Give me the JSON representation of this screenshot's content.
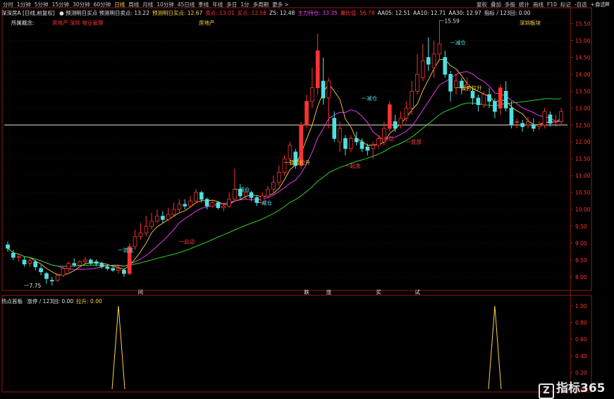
{
  "toolbar": {
    "periods": [
      "分时",
      "1分钟",
      "5分钟",
      "15分钟",
      "30分钟",
      "60分钟",
      "日线",
      "周线",
      "月线",
      "10分钟",
      "45日线",
      "季线",
      "年线",
      "多日",
      "1分",
      "多周期",
      "更多 >"
    ],
    "active_period": "日线",
    "right": [
      "复权",
      "叠加",
      "多股",
      "统计",
      "画线",
      "F10",
      "标记",
      "-自选",
      "+自选"
    ],
    "window_buttons": [
      "▫",
      "⊠"
    ]
  },
  "indicator_bar": {
    "title": "深深房A [日线,前复权]",
    "items": [
      {
        "text": "● 预测明日买点 预测明日卖点: 13.22",
        "color": "#e0e0e0"
      },
      {
        "text": "预测明日买点: 12.67",
        "color": "#ffd24a"
      },
      {
        "text": "卖点: 13.01",
        "color": "#ff3232"
      },
      {
        "text": "买点: 12.58",
        "color": "#ff3232"
      },
      {
        "text": "ZS: 12.48",
        "color": "#e0e0e0"
      },
      {
        "text": "主力持仓: 33.35",
        "color": "#ff40ff"
      },
      {
        "text": "量比值: 56.78",
        "color": "#ff3232"
      },
      {
        "text": "AA05: 12.51",
        "color": "#e0e0e0"
      },
      {
        "text": "AA10: 12.71",
        "color": "#e0e0e0"
      },
      {
        "text": "AA30: 12.97",
        "color": "#e0e0e0"
      },
      {
        "text": "指标 / 123回: 0.00",
        "color": "#e0e0e0"
      }
    ]
  },
  "headers": {
    "concept_label": "所属概念:",
    "concept_value": "房地产 深圳 物业管理",
    "industry": "房地产",
    "region": "深圳板块"
  },
  "price_axis": [
    "15.50",
    "15.00",
    "14.50",
    "14.00",
    "13.50",
    "13.00",
    "12.50",
    "12.00",
    "11.50",
    "11.00",
    "10.50",
    "10.00",
    "9.50",
    "9.00",
    "8.50",
    "8.00"
  ],
  "annotations": [
    {
      "text": "7.75",
      "color": "#e6e6e6"
    },
    {
      "text": "15.59",
      "color": "#e6e6e6"
    },
    {
      "text": "一筑底",
      "color": "#4fe0e0"
    },
    {
      "text": "一启动",
      "color": "#ff4040"
    },
    {
      "text": "一减仓",
      "color": "#4fe0e0"
    },
    {
      "text": "一减仓",
      "color": "#4fe0e0"
    },
    {
      "text": "一启动",
      "color": "#ff4040"
    },
    {
      "text": "一底部",
      "color": "#ff4040"
    },
    {
      "text": "一减仓",
      "color": "#4fe0e0"
    },
    {
      "text": "一减仓",
      "color": "#4fe0e0"
    },
    {
      "text": "一强势拉升",
      "color": "#ffd24a"
    },
    {
      "text": "一起涨",
      "color": "#ff4040"
    },
    {
      "text": "一强势拉升",
      "color": "#ffd24a"
    }
  ],
  "signal_labels": [
    {
      "text": "间",
      "color": "#e6e6e6"
    },
    {
      "text": "跌",
      "color": "#e6e6e6"
    },
    {
      "text": "涨",
      "color": "#e6e6e6"
    },
    {
      "text": "买",
      "color": "#e6e6e6"
    },
    {
      "text": "试",
      "color": "#e6e6e6"
    }
  ],
  "lower_panel": {
    "title": "热点首板",
    "items": [
      {
        "text": "涨停 / 123回: 0.00",
        "color": "#e0e0e0"
      },
      {
        "text": "拉升: 0.00",
        "color": "#ffd24a"
      }
    ],
    "axis": [
      "1.00",
      "0.80",
      "0.60",
      "0.40",
      "0.20",
      "0.00"
    ]
  },
  "logo": {
    "mark": "Z",
    "text": "指标365"
  },
  "chart_data": {
    "type": "candlestick",
    "ylim": [
      7.6,
      15.7
    ],
    "reference_line": 12.5,
    "candles": [
      [
        8.95,
        8.85,
        9.05,
        8.75
      ],
      [
        8.7,
        8.58,
        8.8,
        8.5
      ],
      [
        8.58,
        8.6,
        8.68,
        8.45
      ],
      [
        8.5,
        8.38,
        8.6,
        8.3
      ],
      [
        8.4,
        8.48,
        8.55,
        8.3
      ],
      [
        8.45,
        8.3,
        8.5,
        8.2
      ],
      [
        8.25,
        8.15,
        8.35,
        8.05
      ],
      [
        8.1,
        7.95,
        8.15,
        7.8
      ],
      [
        7.9,
        7.88,
        8.0,
        7.75
      ],
      [
        7.9,
        8.05,
        8.1,
        7.85
      ],
      [
        8.05,
        8.25,
        8.3,
        8.0
      ],
      [
        8.25,
        8.4,
        8.45,
        8.15
      ],
      [
        8.4,
        8.35,
        8.55,
        8.3
      ],
      [
        8.35,
        8.45,
        8.5,
        8.28
      ],
      [
        8.45,
        8.5,
        8.6,
        8.4
      ],
      [
        8.5,
        8.4,
        8.55,
        8.35
      ],
      [
        8.45,
        8.4,
        8.52,
        8.32
      ],
      [
        8.4,
        8.3,
        8.45,
        8.25
      ],
      [
        8.3,
        8.25,
        8.38,
        8.2
      ],
      [
        8.25,
        8.2,
        8.3,
        8.15
      ],
      [
        8.2,
        8.25,
        8.35,
        8.1
      ],
      [
        8.2,
        8.1,
        8.25,
        8.0
      ],
      [
        8.1,
        8.9,
        9.0,
        8.05
      ],
      [
        8.9,
        9.2,
        9.4,
        8.8
      ],
      [
        9.2,
        9.3,
        9.6,
        9.1
      ],
      [
        9.3,
        9.5,
        9.8,
        9.2
      ],
      [
        9.5,
        9.65,
        9.9,
        9.4
      ],
      [
        9.65,
        9.8,
        10.0,
        9.6
      ],
      [
        9.8,
        9.7,
        9.95,
        9.6
      ],
      [
        9.7,
        9.85,
        10.05,
        9.65
      ],
      [
        9.85,
        10.0,
        10.2,
        9.8
      ],
      [
        10.0,
        10.15,
        10.3,
        9.9
      ],
      [
        10.15,
        10.1,
        10.3,
        10.0
      ],
      [
        10.1,
        10.25,
        10.4,
        10.05
      ],
      [
        10.25,
        10.5,
        10.6,
        10.2
      ],
      [
        10.5,
        10.3,
        10.55,
        10.2
      ],
      [
        10.3,
        10.1,
        10.35,
        10.0
      ],
      [
        10.1,
        10.2,
        10.3,
        10.05
      ],
      [
        10.2,
        10.05,
        10.25,
        10.0
      ],
      [
        10.05,
        10.1,
        10.2,
        9.95
      ],
      [
        10.1,
        10.3,
        10.5,
        10.05
      ],
      [
        10.3,
        10.6,
        11.2,
        10.25
      ],
      [
        10.6,
        10.4,
        10.75,
        10.3
      ],
      [
        10.4,
        10.5,
        10.6,
        10.3
      ],
      [
        10.5,
        10.35,
        10.55,
        10.25
      ],
      [
        10.35,
        10.2,
        10.4,
        10.1
      ],
      [
        10.2,
        10.4,
        10.5,
        10.15
      ],
      [
        10.4,
        10.6,
        10.7,
        10.35
      ],
      [
        10.6,
        10.8,
        11.0,
        10.5
      ],
      [
        10.8,
        11.1,
        11.3,
        10.7
      ],
      [
        11.1,
        11.5,
        11.6,
        11.0
      ],
      [
        11.5,
        11.9,
        12.0,
        11.3
      ],
      [
        11.7,
        11.3,
        11.8,
        11.2
      ],
      [
        11.3,
        12.5,
        12.6,
        11.2
      ],
      [
        12.5,
        13.2,
        13.4,
        12.4
      ],
      [
        13.2,
        13.6,
        14.2,
        13.0
      ],
      [
        13.6,
        14.7,
        15.2,
        13.4
      ],
      [
        13.8,
        13.3,
        14.5,
        13.1
      ],
      [
        13.3,
        13.8,
        13.9,
        12.4
      ],
      [
        12.7,
        12.1,
        12.9,
        12.0
      ],
      [
        12.0,
        12.4,
        12.6,
        11.7
      ],
      [
        12.1,
        11.8,
        12.2,
        11.6
      ],
      [
        11.8,
        12.1,
        12.2,
        11.7
      ],
      [
        12.1,
        12.0,
        12.3,
        11.9
      ],
      [
        12.0,
        11.8,
        12.1,
        11.7
      ],
      [
        11.85,
        11.75,
        11.95,
        11.6
      ],
      [
        11.8,
        11.9,
        12.0,
        11.5
      ],
      [
        11.9,
        12.1,
        12.2,
        11.8
      ],
      [
        12.0,
        12.4,
        12.6,
        11.9
      ],
      [
        12.4,
        13.1,
        13.2,
        12.3
      ],
      [
        12.6,
        12.4,
        12.8,
        12.3
      ],
      [
        12.5,
        12.7,
        12.9,
        12.4
      ],
      [
        12.7,
        13.0,
        13.2,
        12.6
      ],
      [
        13.0,
        13.5,
        13.8,
        12.8
      ],
      [
        13.5,
        14.0,
        14.6,
        13.4
      ],
      [
        13.9,
        14.4,
        14.9,
        13.8
      ],
      [
        14.5,
        14.3,
        15.1,
        14.1
      ],
      [
        14.2,
        14.6,
        15.0,
        13.9
      ],
      [
        14.6,
        14.9,
        15.6,
        14.4
      ],
      [
        14.5,
        14.0,
        14.7,
        13.9
      ],
      [
        14.0,
        13.5,
        14.1,
        13.2
      ],
      [
        13.6,
        13.8,
        14.0,
        13.4
      ],
      [
        13.8,
        13.6,
        13.9,
        13.4
      ],
      [
        13.6,
        13.7,
        13.9,
        13.5
      ],
      [
        13.5,
        13.3,
        13.6,
        13.1
      ],
      [
        13.3,
        13.1,
        13.4,
        12.9
      ],
      [
        13.1,
        13.4,
        13.5,
        13.0
      ],
      [
        13.4,
        13.2,
        13.6,
        13.0
      ],
      [
        13.2,
        12.9,
        13.3,
        12.7
      ],
      [
        13.0,
        13.6,
        13.7,
        12.8
      ],
      [
        13.5,
        13.0,
        13.8,
        12.9
      ],
      [
        13.0,
        12.5,
        13.2,
        12.4
      ],
      [
        12.6,
        12.6,
        12.7,
        12.4
      ],
      [
        12.55,
        12.45,
        12.65,
        12.3
      ],
      [
        12.5,
        12.6,
        12.75,
        12.4
      ],
      [
        12.5,
        12.4,
        12.7,
        12.3
      ],
      [
        12.45,
        12.5,
        12.6,
        12.35
      ],
      [
        12.5,
        12.9,
        13.0,
        12.4
      ],
      [
        12.8,
        12.55,
        12.9,
        12.45
      ],
      [
        12.6,
        12.6,
        12.8,
        12.45
      ],
      [
        12.6,
        12.9,
        13.0,
        12.5
      ]
    ],
    "pulses": [
      {
        "index": 20,
        "value": 1.0
      },
      {
        "index": 88,
        "value": 1.0
      }
    ],
    "ma_colors": {
      "short": "#ffd24a",
      "mid": "#ff40ff",
      "long": "#2ee82e"
    },
    "up_color": "#ff3232",
    "down_color": "#4fe0e0"
  }
}
